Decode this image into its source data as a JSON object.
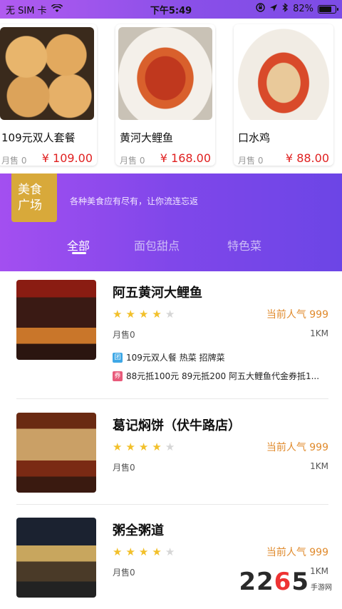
{
  "status_bar": {
    "carrier": "无 SIM 卡",
    "time": "下午5:49",
    "battery": "82%",
    "battery_level": 0.82
  },
  "top_cards": [
    {
      "name": "109元双人套餐",
      "sold": "月售 0",
      "price": "¥ 109.00"
    },
    {
      "name": "黄河大鲤鱼",
      "sold": "月售 0",
      "price": "¥ 168.00"
    },
    {
      "name": "口水鸡",
      "sold": "月售 0",
      "price": "¥ 88.00"
    }
  ],
  "section": {
    "badge_line1": "美食",
    "badge_line2": "广场",
    "slogan": "各种美食应有尽有，让你流连忘返",
    "tabs": [
      "全部",
      "面包甜点",
      "特色菜"
    ],
    "active_tab": 0
  },
  "restaurants": [
    {
      "name": "阿五黄河大鲤鱼",
      "rating": 4,
      "popularity": "当前人气 999",
      "sold": "月售0",
      "distance": "1KM",
      "promos": [
        {
          "tag": "团",
          "text": "109元双人餐 热菜 招牌菜"
        },
        {
          "tag": "券",
          "text": "88元抵100元 89元抵200 阿五大鲤鱼代金券抵1..."
        }
      ]
    },
    {
      "name": "葛记焖饼（伏牛路店）",
      "rating": 4,
      "popularity": "当前人气 999",
      "sold": "月售0",
      "distance": "1KM",
      "promos": []
    },
    {
      "name": "粥全粥道",
      "rating": 4,
      "popularity": "当前人气 999",
      "sold": "月售0",
      "distance": "1KM",
      "promos": []
    }
  ],
  "colors": {
    "price_red": "#e02020",
    "popularity_orange": "#e08a2c",
    "star_gold": "#f2c02a",
    "star_gray": "#d6d6d6",
    "purple_start": "#a34ff0",
    "purple_end": "#6c45e6",
    "badge_gold": "#d8a93a"
  },
  "icons": {
    "wifi": "wifi-icon",
    "location": "location-arrow-icon",
    "bluetooth": "bluetooth-icon",
    "lock_rotation": "orientation-lock-icon",
    "battery": "battery-icon",
    "star": "star-icon"
  },
  "watermark": {
    "text_a": "22",
    "text_b": "6",
    "text_c": "5",
    "sub": "手游网"
  }
}
